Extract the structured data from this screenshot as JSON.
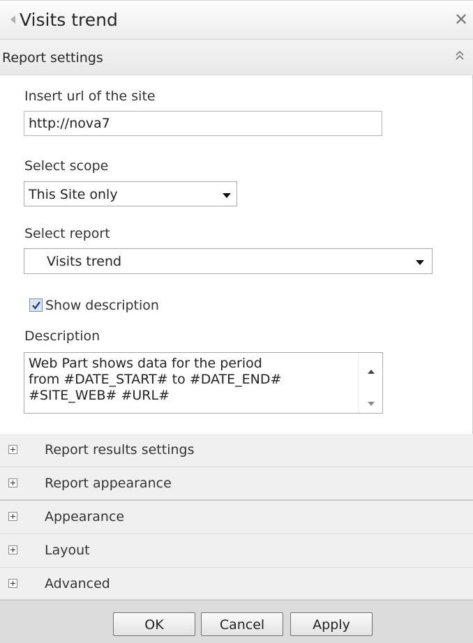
{
  "window": {
    "title": "Visits trend",
    "close_symbol": "✕"
  },
  "report_settings": {
    "header": "Report settings",
    "url_label": "Insert url of the site",
    "url_value": "http://nova7",
    "scope_label": "Select scope",
    "scope_value": "This Site only",
    "report_label": "Select report",
    "report_value": "Visits trend",
    "show_description_label": "Show description",
    "show_description_checked": true,
    "description_label": "Description",
    "description_lines": [
      "Web Part shows data for the period",
      "from #DATE_START# to #DATE_END#",
      "#SITE_WEB# #URL#"
    ]
  },
  "sections": [
    {
      "label": "Report results settings"
    },
    {
      "label": "Report appearance"
    },
    {
      "label": "Appearance"
    },
    {
      "label": "Layout"
    },
    {
      "label": "Advanced"
    }
  ],
  "buttons": {
    "ok": "OK",
    "cancel": "Cancel",
    "apply": "Apply"
  }
}
